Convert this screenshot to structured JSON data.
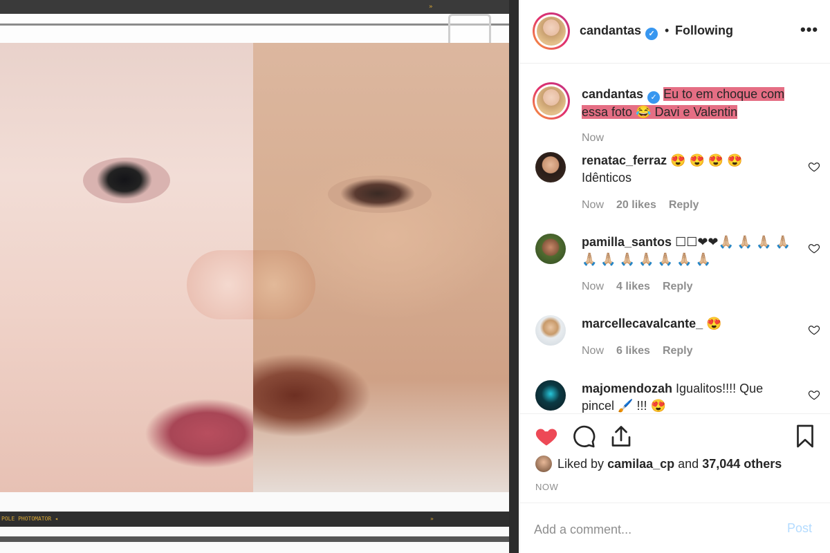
{
  "header": {
    "username": "candantas",
    "separator": "•",
    "follow_status": "Following",
    "more": "•••"
  },
  "caption": {
    "username": "candantas",
    "text": "Eu to em choque com essa foto 😂  Davi e Valentin",
    "time": "Now"
  },
  "comments": [
    {
      "username": "renatac_ferraz",
      "text": "😍 😍 😍 😍",
      "line2": "Idênticos",
      "time": "Now",
      "likes": "20 likes",
      "reply": "Reply"
    },
    {
      "username": "pamilla_santos",
      "text": "☐☐❤❤🙏🏼 🙏🏼 🙏🏼 🙏🏼",
      "line2": "🙏🏼 🙏🏼 🙏🏼 🙏🏼 🙏🏼 🙏🏼 🙏🏼",
      "time": "Now",
      "likes": "4 likes",
      "reply": "Reply"
    },
    {
      "username": "marcellecavalcante_",
      "text": "😍",
      "line2": "",
      "time": "Now",
      "likes": "6 likes",
      "reply": "Reply"
    },
    {
      "username": "majomendozah",
      "text": "Igualitos!!!! Que",
      "line2": "pincel 🖌️  !!! 😍",
      "time": "",
      "likes": "",
      "reply": ""
    }
  ],
  "actions": {
    "liked_prefix": "Liked by",
    "liked_user": "camilaa_cp",
    "liked_and": "and",
    "liked_count": "37,044 others",
    "timestamp": "NOW"
  },
  "add_comment": {
    "placeholder": "Add a comment...",
    "post_label": "Post"
  },
  "photo": {
    "film_mark_top": "»",
    "film_mark_bottom": "POLE PHOTOMATOR ◂",
    "film_mark_bottom2": "»"
  },
  "colors": {
    "like_red": "#ed4956",
    "verified_blue": "#3897f0",
    "caption_highlight": "#e56e84",
    "post_disabled": "#b3dbff"
  }
}
